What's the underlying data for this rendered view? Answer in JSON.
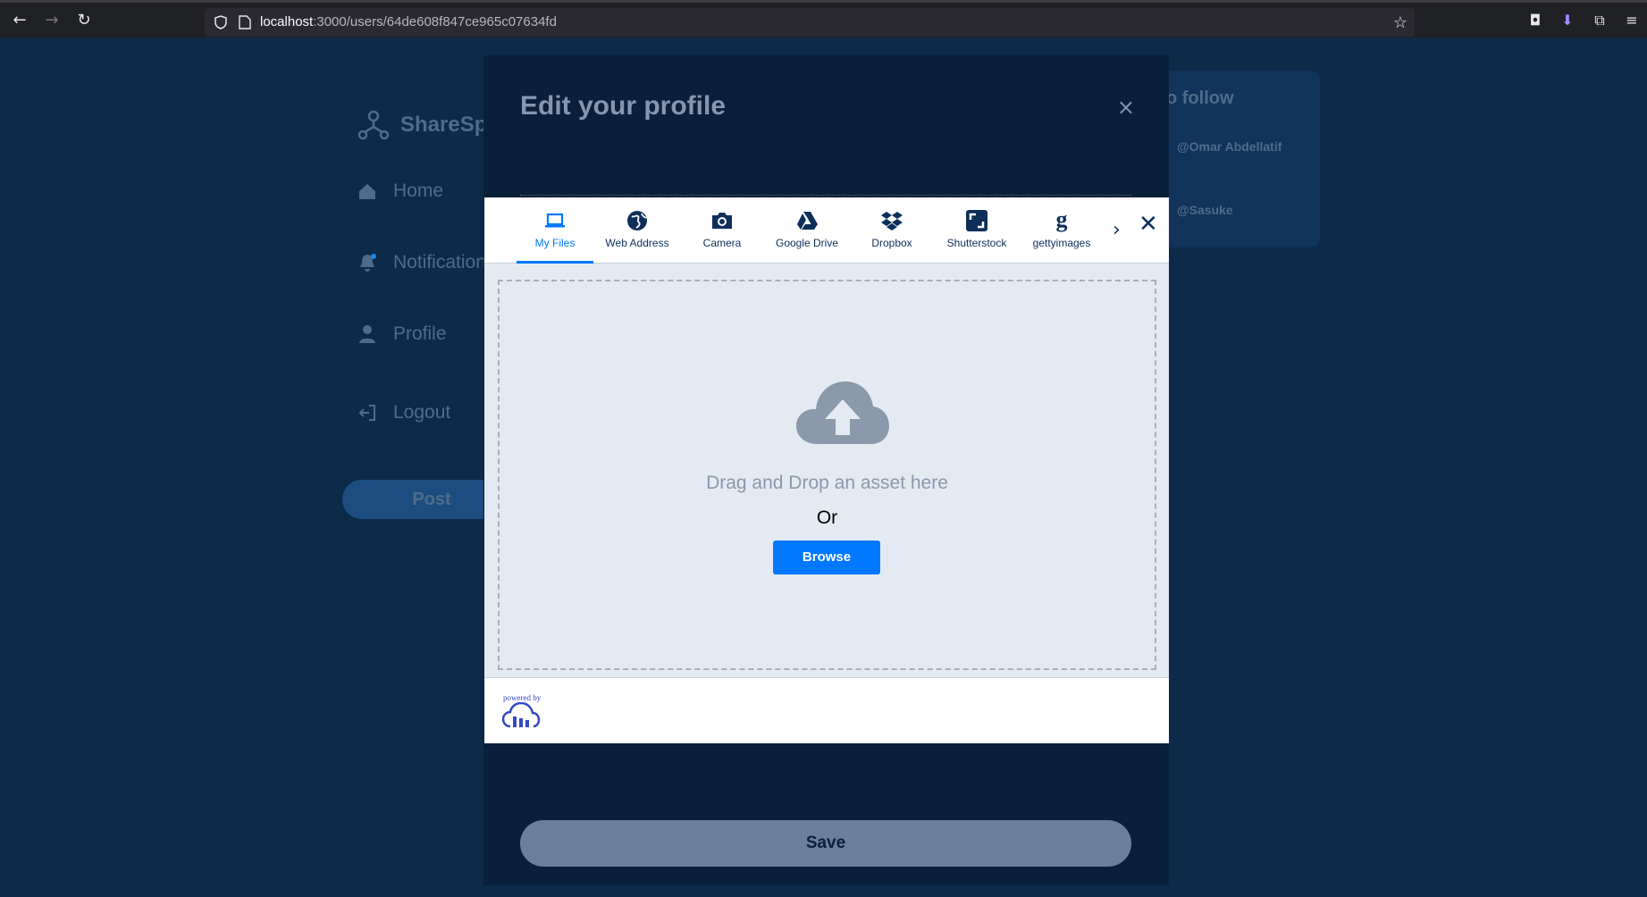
{
  "browser": {
    "url_host": "localhost",
    "url_path": ":3000/users/64de608f847ce965c07634fd"
  },
  "app": {
    "brand": "ShareSp",
    "nav": [
      {
        "label": "Home",
        "icon": "home-icon"
      },
      {
        "label": "Notifications",
        "icon": "bell-icon"
      },
      {
        "label": "Profile",
        "icon": "user-icon"
      },
      {
        "label": "Logout",
        "icon": "logout-icon"
      }
    ],
    "post_label": "Post",
    "who_to_follow": {
      "title": "o follow",
      "handles": [
        "@Omar Abdellatif",
        "@Sasuke"
      ]
    }
  },
  "edit_modal": {
    "title": "Edit your profile",
    "close": "×",
    "save_label": "Save"
  },
  "upload_widget": {
    "tabs": [
      {
        "label": "My Files",
        "icon": "laptop-icon",
        "active": true
      },
      {
        "label": "Web Address",
        "icon": "globe-icon"
      },
      {
        "label": "Camera",
        "icon": "camera-icon"
      },
      {
        "label": "Google Drive",
        "icon": "google-drive-icon"
      },
      {
        "label": "Dropbox",
        "icon": "dropbox-icon"
      },
      {
        "label": "Shutterstock",
        "icon": "shutterstock-icon"
      },
      {
        "label": "gettyimages",
        "icon": "gettyimages-icon"
      }
    ],
    "next": "›",
    "close": "✕",
    "drag_text": "Drag and Drop an asset here",
    "or_text": "Or",
    "browse_label": "Browse",
    "powered_by": "powered by"
  },
  "colors": {
    "accent": "#0078ff",
    "page_bg": "#0d2a48",
    "modal_bg": "#0a1f3a"
  }
}
